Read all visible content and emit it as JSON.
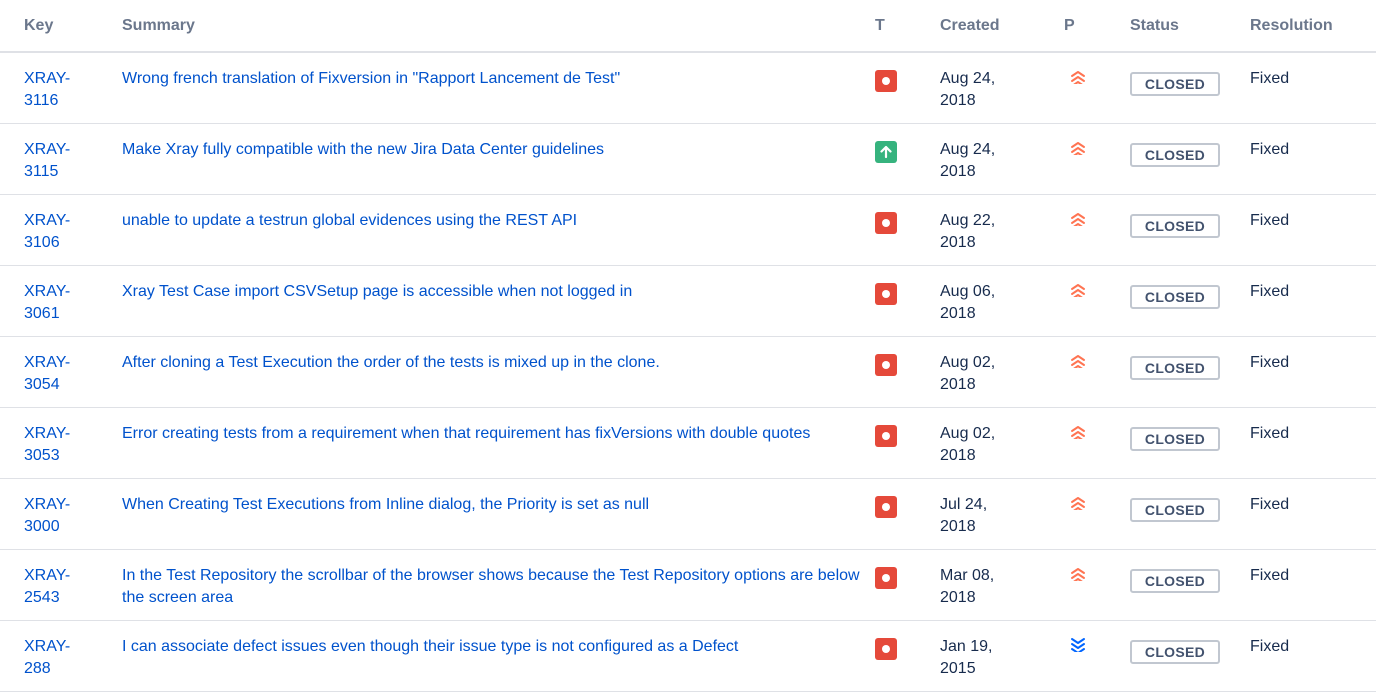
{
  "headers": {
    "key": "Key",
    "summary": "Summary",
    "type": "T",
    "created": "Created",
    "priority": "P",
    "status": "Status",
    "resolution": "Resolution"
  },
  "colors": {
    "link": "#0052cc",
    "bug": "#e5493a",
    "improvement": "#36b37e",
    "highest_priority": "#ff7452",
    "lowest_priority": "#0065ff",
    "header_text": "#6b778c"
  },
  "rows": [
    {
      "key_line1": "XRAY-",
      "key_line2": "3116",
      "summary": "Wrong french translation of Fixversion in \"Rapport Lancement de Test\"",
      "type": "bug",
      "type_icon": "bug-icon",
      "created_line1": "Aug 24,",
      "created_line2": "2018",
      "priority": "highest",
      "priority_icon": "highest-priority-icon",
      "status": "CLOSED",
      "resolution": "Fixed"
    },
    {
      "key_line1": "XRAY-",
      "key_line2": "3115",
      "summary": "Make Xray fully compatible with the new Jira Data Center guidelines",
      "type": "improvement",
      "type_icon": "improvement-icon",
      "created_line1": "Aug 24,",
      "created_line2": "2018",
      "priority": "highest",
      "priority_icon": "highest-priority-icon",
      "status": "CLOSED",
      "resolution": "Fixed"
    },
    {
      "key_line1": "XRAY-",
      "key_line2": "3106",
      "summary": "unable to update a testrun global evidences using the REST API",
      "type": "bug",
      "type_icon": "bug-icon",
      "created_line1": "Aug 22,",
      "created_line2": "2018",
      "priority": "highest",
      "priority_icon": "highest-priority-icon",
      "status": "CLOSED",
      "resolution": "Fixed"
    },
    {
      "key_line1": "XRAY-",
      "key_line2": "3061",
      "summary": "Xray Test Case import CSVSetup page is accessible when not logged in",
      "type": "bug",
      "type_icon": "bug-icon",
      "created_line1": "Aug 06,",
      "created_line2": "2018",
      "priority": "highest",
      "priority_icon": "highest-priority-icon",
      "status": "CLOSED",
      "resolution": "Fixed"
    },
    {
      "key_line1": "XRAY-",
      "key_line2": "3054",
      "summary": "After cloning a Test Execution the order of the tests is mixed up in the clone.",
      "type": "bug",
      "type_icon": "bug-icon",
      "created_line1": "Aug 02,",
      "created_line2": "2018",
      "priority": "highest",
      "priority_icon": "highest-priority-icon",
      "status": "CLOSED",
      "resolution": "Fixed"
    },
    {
      "key_line1": "XRAY-",
      "key_line2": "3053",
      "summary": "Error creating tests from a requirement when that requirement has fixVersions with double quotes",
      "type": "bug",
      "type_icon": "bug-icon",
      "created_line1": "Aug 02,",
      "created_line2": "2018",
      "priority": "highest",
      "priority_icon": "highest-priority-icon",
      "status": "CLOSED",
      "resolution": "Fixed"
    },
    {
      "key_line1": "XRAY-",
      "key_line2": "3000",
      "summary": "When Creating Test Executions from Inline dialog, the Priority is set as null",
      "type": "bug",
      "type_icon": "bug-icon",
      "created_line1": "Jul 24,",
      "created_line2": "2018",
      "priority": "highest",
      "priority_icon": "highest-priority-icon",
      "status": "CLOSED",
      "resolution": "Fixed"
    },
    {
      "key_line1": "XRAY-",
      "key_line2": "2543",
      "summary": "In the Test Repository the scrollbar of the browser shows because the Test Repository options are below the screen area",
      "type": "bug",
      "type_icon": "bug-icon",
      "created_line1": "Mar 08,",
      "created_line2": "2018",
      "priority": "highest",
      "priority_icon": "highest-priority-icon",
      "status": "CLOSED",
      "resolution": "Fixed"
    },
    {
      "key_line1": "XRAY-",
      "key_line2": "288",
      "summary": "I can associate defect issues even though their issue type is not configured as a Defect",
      "type": "bug",
      "type_icon": "bug-icon",
      "created_line1": "Jan 19,",
      "created_line2": "2015",
      "priority": "lowest",
      "priority_icon": "lowest-priority-icon",
      "status": "CLOSED",
      "resolution": "Fixed"
    }
  ]
}
